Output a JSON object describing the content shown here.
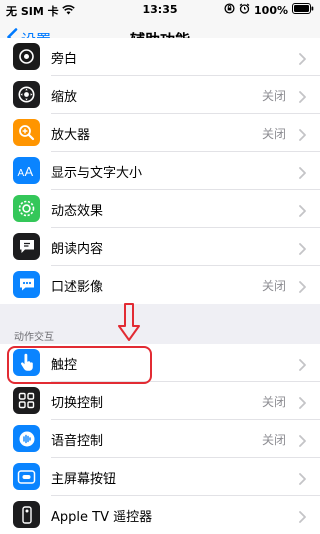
{
  "status": {
    "carrier": "无 SIM 卡",
    "time": "13:35",
    "battery": "100%"
  },
  "nav": {
    "back_label": "设置",
    "title": "辅助功能"
  },
  "group1": [
    {
      "label": "旁白",
      "value": "",
      "icon": "voiceover-icon",
      "color": "#1a1a1a"
    },
    {
      "label": "缩放",
      "value": "关闭",
      "icon": "zoom-icon",
      "color": "#1c1c1e"
    },
    {
      "label": "放大器",
      "value": "关闭",
      "icon": "magnifier-icon",
      "color": "#ff9500"
    },
    {
      "label": "显示与文字大小",
      "value": "",
      "icon": "text-size-icon",
      "color": "#0a84ff"
    },
    {
      "label": "动态效果",
      "value": "",
      "icon": "motion-icon",
      "color": "#34c759"
    },
    {
      "label": "朗读内容",
      "value": "",
      "icon": "spoken-content-icon",
      "color": "#1c1c1e"
    },
    {
      "label": "口述影像",
      "value": "关闭",
      "icon": "audio-description-icon",
      "color": "#0a84ff"
    }
  ],
  "section2": {
    "header": "动作交互",
    "items": [
      {
        "label": "触控",
        "value": "",
        "icon": "touch-icon",
        "color": "#0a84ff"
      },
      {
        "label": "切换控制",
        "value": "关闭",
        "icon": "switch-control-icon",
        "color": "#1c1c1e"
      },
      {
        "label": "语音控制",
        "value": "关闭",
        "icon": "voice-control-icon",
        "color": "#0a84ff"
      },
      {
        "label": "主屏幕按钮",
        "value": "",
        "icon": "home-button-icon",
        "color": "#0a84ff"
      },
      {
        "label": "Apple TV 遥控器",
        "value": "",
        "icon": "apple-tv-remote-icon",
        "color": "#1c1c1e"
      }
    ]
  },
  "annotation_color": "#e22b33"
}
